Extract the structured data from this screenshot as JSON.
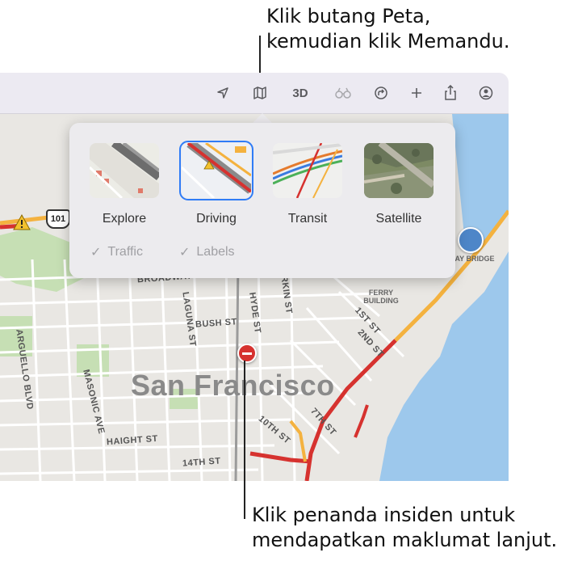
{
  "callouts": {
    "top": [
      "Klik butang Peta,",
      "kemudian klik Memandu."
    ],
    "bottom": [
      "Klik penanda insiden untuk",
      "mendapatkan maklumat lanjut."
    ]
  },
  "toolbar": {
    "three_d_label": "3D",
    "icons": [
      "location-arrow-icon",
      "map-icon",
      "binoculars-icon",
      "route-icon",
      "plus-icon",
      "share-icon",
      "account-icon"
    ]
  },
  "map_modes": [
    {
      "label": "Explore"
    },
    {
      "label": "Driving",
      "selected": true
    },
    {
      "label": "Transit"
    },
    {
      "label": "Satellite"
    }
  ],
  "options": {
    "traffic_label": "Traffic",
    "labels_label": "Labels"
  },
  "map": {
    "city_label": "San Francisco",
    "highway_shield": "101",
    "streets": [
      "BROADWAY",
      "LAGUNA ST",
      "HYDE ST",
      "BUSH ST",
      "ARGUELLO BLVD",
      "MASONIC AVE",
      "HAIGHT ST",
      "14TH ST",
      "10TH ST",
      "7TH ST",
      "1ST ST",
      "2ND ST",
      "LARKIN ST"
    ],
    "poi": [
      "FERRY BUILDING",
      "BAY BRIDGE"
    ]
  },
  "colors": {
    "accent": "#2f7cf6",
    "water": "#9dc8ec",
    "traffic_red": "#d6322f",
    "park": "#c6dfb4"
  }
}
